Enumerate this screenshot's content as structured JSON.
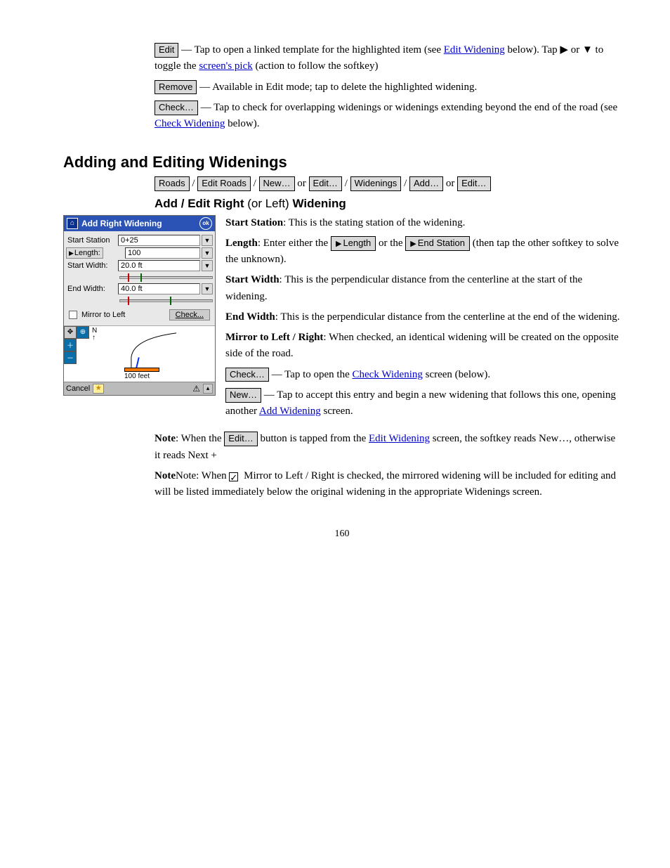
{
  "buttons": {
    "edit": "Edit",
    "remove": "Remove",
    "check": "Check…",
    "roads": "Roads",
    "edit_roads": "Edit Roads",
    "new": "New…",
    "edit_dots": "Edit…",
    "widenings": "Widenings",
    "add": "Add…",
    "length": "Length",
    "end_station": "End Station"
  },
  "links": {
    "check_widening": "Check Widening",
    "add_widening": "Add Widening",
    "edit_widening": "Edit Widening",
    "screens_pick": "screen's pick"
  },
  "para": {
    "p1a": " — Tap to open a linked template for the highlighted item (see ",
    "p1b": " below). Tap ▶ or ▼ to toggle the ",
    "p1c": " (action to follow the softkey)",
    "p2": " — Available in Edit mode; tap to delete the highlighted widening.",
    "p3a": " — Tap to check for overlapping widenings or widenings extending beyond the end of the road (see ",
    "p3b": " below).",
    "h2": "Adding and Editing Widenings",
    "path1": "/",
    "path2": "/",
    "path3": " or ",
    "path4": "/",
    "path5": "/",
    "path6": " or ",
    "h3": "Add / Edit Right (or Left) Widening",
    "ss": "Start Station: This is the stating station of the widening.",
    "len": "Length: Enter either the  or the  (then tap the other softkey to solve the unknown).",
    "len_a": "Length: Enter either the ",
    "len_b": " or the ",
    "len_c": " (then tap the other softkey to solve the unknown).",
    "sw": "Start Width: This is the perpendicular distance from the centerline at the start of the widening.",
    "ew": "End Width: This is the perpendicular distance from the centerline at the end of the widening.",
    "m2l": "Mirror to Left / Right: When checked, an identical widening will be created on the opposite side of the road.",
    "chk_a": " — Tap to open the ",
    "chk_b": " screen (below).",
    "new_a": " — Tap to accept this entry and begin a new widening that follows this one, opening another ",
    "new_b": " screen.",
    "note1_a": "Note: When the ",
    "note1_b": " button is tapped from the ",
    "note1_c": " screen, the softkey reads New…, otherwise it reads Next +",
    "note2_a": "Note: When ",
    "note2_b": " Mirror to Left / Right is checked, the mirrored widening will be included for editing and will be listed immediately below the original widening in the appropriate Widenings screen."
  },
  "device": {
    "title": "Add Right Widening",
    "ok": "ok",
    "start_station_lbl": "Start Station",
    "start_station_val": "0+25",
    "length_lbl": "Length:",
    "length_val": "100",
    "start_width_lbl": "Start Width:",
    "start_width_val": "20.0 ft",
    "end_width_lbl": "End Width:",
    "end_width_val": "40.0 ft",
    "mirror_lbl": "Mirror to Left",
    "check_btn": "Check...",
    "scale_label": "100 feet",
    "cancel": "Cancel"
  },
  "page_number": "160"
}
